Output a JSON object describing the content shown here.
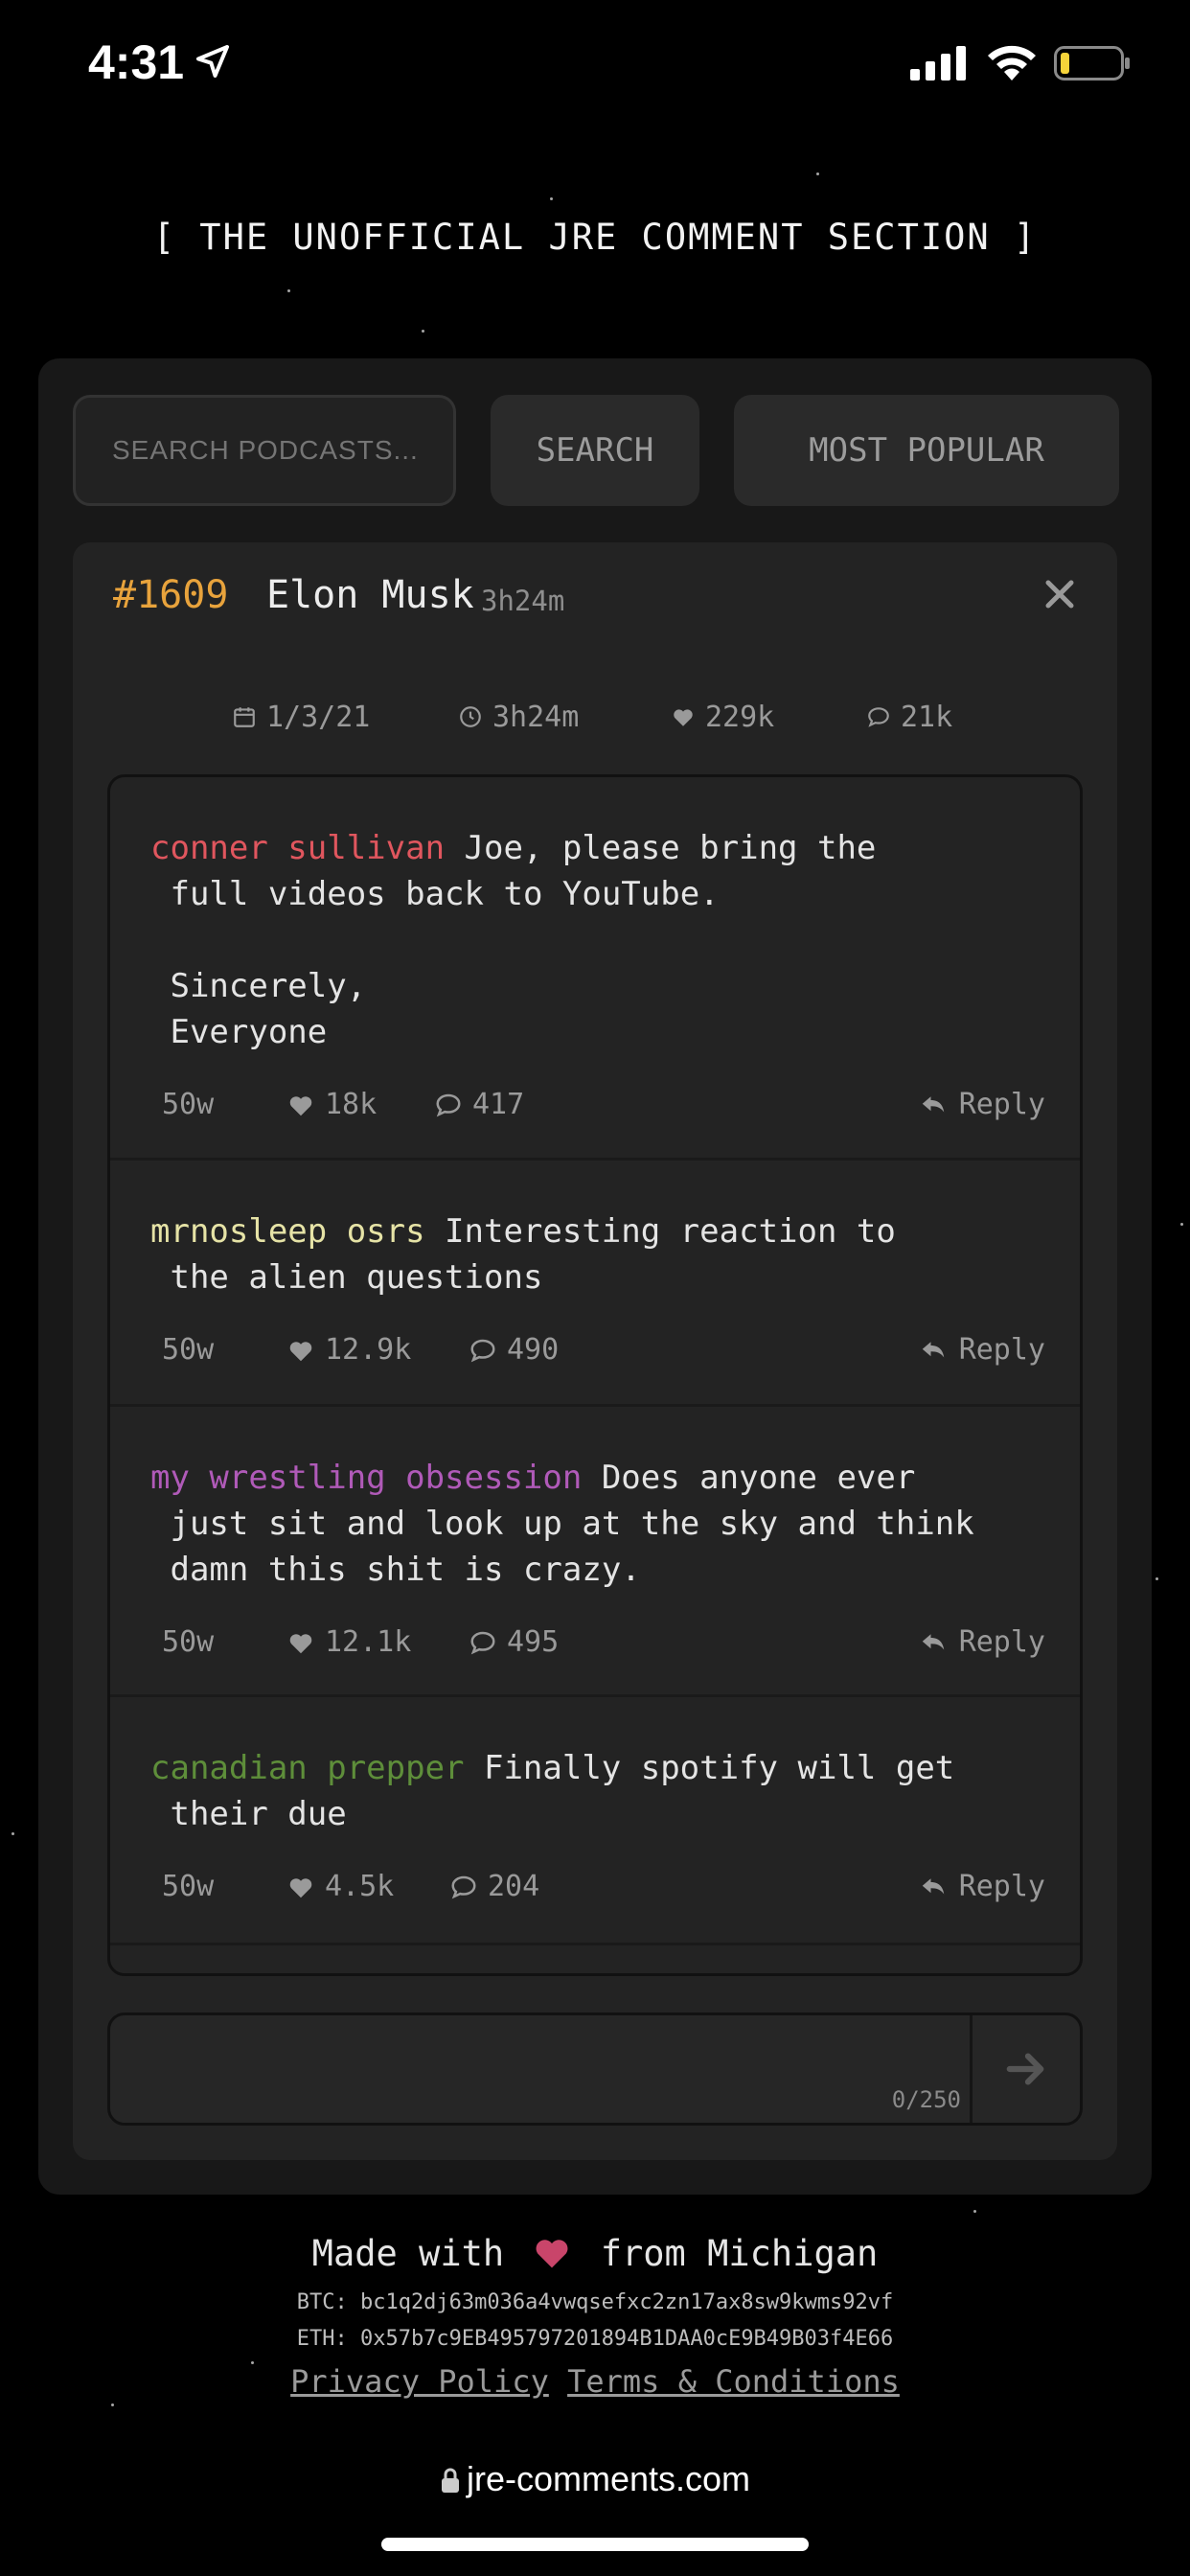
{
  "status_bar": {
    "time": "4:31"
  },
  "site_title": "[ THE UNOFFICIAL JRE COMMENT SECTION ]",
  "toolbar": {
    "search_placeholder": "SEARCH PODCASTS...",
    "search_label": "SEARCH",
    "popular_label": "MOST POPULAR"
  },
  "episode": {
    "number": "#1609",
    "guest": "Elon Musk",
    "duration": "3h24m",
    "stats": {
      "date": "1/3/21",
      "duration": "3h24m",
      "likes": "229k",
      "comments": "21k"
    }
  },
  "comments": [
    {
      "author": "conner sullivan",
      "author_color": "#e0565e",
      "text": " Joe, please bring the\n full videos back to YouTube.\n\n Sincerely,\n Everyone",
      "age": "50w",
      "likes": "18k",
      "replies": "417",
      "reply_label": "Reply"
    },
    {
      "author": "mrnosleep osrs",
      "author_color": "#e6e3a6",
      "text": " Interesting reaction to\n the alien questions",
      "age": "50w",
      "likes": "12.9k",
      "replies": "490",
      "reply_label": "Reply"
    },
    {
      "author": "my wrestling obsession",
      "author_color": "#b05ab8",
      "text": " Does anyone ever\n just sit and look up at the sky and think\n damn this shit is crazy.",
      "age": "50w",
      "likes": "12.1k",
      "replies": "495",
      "reply_label": "Reply"
    },
    {
      "author": "canadian prepper",
      "author_color": "#5e8e3a",
      "text": " Finally spotify will get\n their due",
      "age": "50w",
      "likes": "4.5k",
      "replies": "204",
      "reply_label": "Reply"
    }
  ],
  "composer": {
    "counter": "0/250"
  },
  "footer": {
    "made_prefix": "Made with",
    "made_suffix": "from Michigan",
    "btc": "BTC: bc1q2dj63m036a4vwqsefxc2zn17ax8sw9kwms92vf",
    "eth": "ETH: 0x57b7c9EB495797201894B1DAA0cE9B49B03f4E66",
    "privacy": "Privacy Policy",
    "terms": "Terms & Conditions"
  },
  "browser": {
    "url": "jre-comments.com"
  },
  "colors": {
    "accent": "#e8a33c",
    "heart": "#c9456a"
  }
}
